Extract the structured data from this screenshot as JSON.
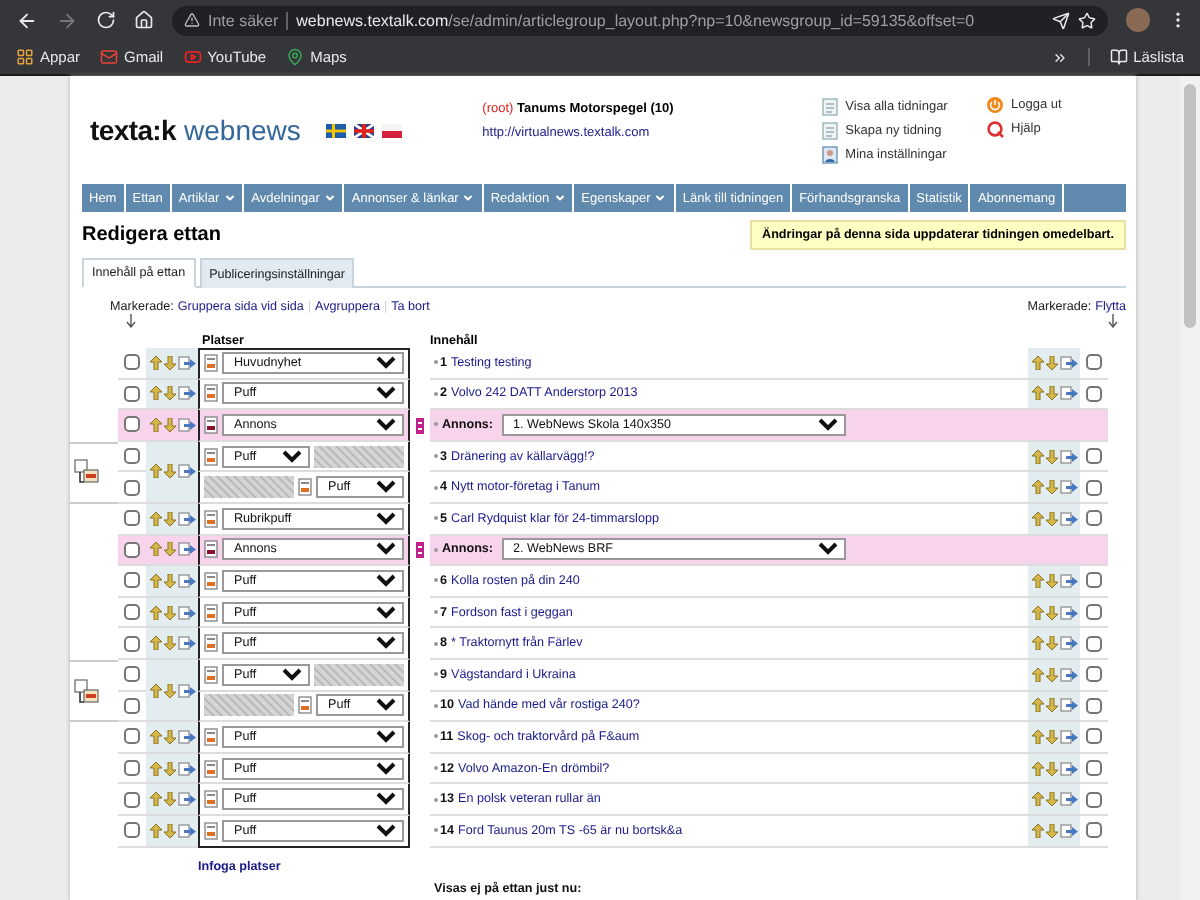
{
  "browser": {
    "security": "Inte säker",
    "url_host": "webnews.textalk.com",
    "url_path": "/se/admin/articlegroup_layout.php?np=10&newsgroup_id=59135&offset=0",
    "bookmarks": [
      {
        "label": "Appar",
        "kind": "apps"
      },
      {
        "label": "Gmail",
        "kind": "mail"
      },
      {
        "label": "YouTube",
        "kind": "video"
      },
      {
        "label": "Maps",
        "kind": "map"
      }
    ],
    "reading_list": "Läslista"
  },
  "header": {
    "logo_left": "texta:k",
    "logo_right": "webnews",
    "role": "(root)",
    "paper": "Tanums Motorspegel (10)",
    "paper_url": "http://virtualnews.textalk.com",
    "links": [
      {
        "label": "Visa alla tidningar",
        "kind": "list"
      },
      {
        "label": "Skapa ny tidning",
        "kind": "list"
      },
      {
        "label": "Mina inställningar",
        "kind": "user"
      }
    ],
    "links_right": [
      {
        "label": "Logga ut",
        "kind": "power"
      },
      {
        "label": "Hjälp",
        "kind": "help"
      }
    ]
  },
  "nav": [
    {
      "label": "Hem",
      "dropdown": false
    },
    {
      "label": "Ettan",
      "dropdown": false
    },
    {
      "label": "Artiklar",
      "dropdown": true
    },
    {
      "label": "Avdelningar",
      "dropdown": true
    },
    {
      "label": "Annonser & länkar",
      "dropdown": true
    },
    {
      "label": "Redaktion",
      "dropdown": true
    },
    {
      "label": "Egenskaper",
      "dropdown": true
    },
    {
      "label": "Länk till tidningen",
      "dropdown": false
    },
    {
      "label": "Förhandsgranska",
      "dropdown": false
    },
    {
      "label": "Statistik",
      "dropdown": false
    },
    {
      "label": "Abonnemang",
      "dropdown": false
    }
  ],
  "page_title": "Redigera ettan",
  "notice": "Ändringar på denna sida uppdaterar tidningen omedelbart.",
  "tabs": [
    {
      "label": "Innehåll på ettan",
      "selected": true
    },
    {
      "label": "Publiceringsinställningar",
      "selected": false
    }
  ],
  "bulk_left": {
    "label": "Markerade:",
    "separator": "|",
    "actions": [
      "Gruppera sida vid sida",
      "Avgruppera",
      "Ta bort"
    ]
  },
  "bulk_right": {
    "label": "Markerade:",
    "actions": [
      "Flytta"
    ]
  },
  "columns": {
    "places": "Platser",
    "content": "Innehåll"
  },
  "rows": [
    {
      "kind": "single",
      "place": "Huvudnyhet",
      "num": "1",
      "title": "Testing testing",
      "checked": false,
      "checked_right": false
    },
    {
      "kind": "single",
      "place": "Puff",
      "num": "2",
      "title": "Volvo 242 DATT Anderstorp 2013",
      "checked": false,
      "checked_right": false
    },
    {
      "kind": "ad",
      "place": "Annons",
      "ad_label": "Annons:",
      "ad_value": "1. WebNews Skola 140x350",
      "checked": false
    },
    {
      "kind": "pair",
      "items": [
        {
          "place": "Puff",
          "num": "3",
          "title": "Dränering av källarvägg!?",
          "checked": false,
          "checked_right": false
        },
        {
          "place": "Puff",
          "num": "4",
          "title": "Nytt motor-företag i Tanum",
          "checked": false,
          "checked_right": false
        }
      ]
    },
    {
      "kind": "single",
      "place": "Rubrikpuff",
      "num": "5",
      "title": "Carl Rydquist klar för 24-timmarslopp",
      "checked": false,
      "checked_right": false
    },
    {
      "kind": "ad",
      "place": "Annons",
      "ad_label": "Annons:",
      "ad_value": "2. WebNews BRF",
      "checked": false
    },
    {
      "kind": "single",
      "place": "Puff",
      "num": "6",
      "title": "Kolla rosten på din 240",
      "checked": false,
      "checked_right": false
    },
    {
      "kind": "single",
      "place": "Puff",
      "num": "7",
      "title": "Fordson fast i geggan",
      "checked": false,
      "checked_right": false
    },
    {
      "kind": "single",
      "place": "Puff",
      "num": "8",
      "title": "* Traktornytt från Färlev",
      "checked": false,
      "checked_right": false
    },
    {
      "kind": "pair",
      "items": [
        {
          "place": "Puff",
          "num": "9",
          "title": "Vägstandard i Ukraina",
          "checked": false,
          "checked_right": false
        },
        {
          "place": "Puff",
          "num": "10",
          "title": "Vad hände med vår rostiga 240?",
          "checked": false,
          "checked_right": false
        }
      ]
    },
    {
      "kind": "single",
      "place": "Puff",
      "num": "11",
      "title": "Skog- och traktorvård på F&aum",
      "checked": false,
      "checked_right": false
    },
    {
      "kind": "single",
      "place": "Puff",
      "num": "12",
      "title": "Volvo Amazon-En drömbil?",
      "checked": false,
      "checked_right": false
    },
    {
      "kind": "single",
      "place": "Puff",
      "num": "13",
      "title": "En polsk veteran rullar än",
      "checked": false,
      "checked_right": false
    },
    {
      "kind": "single",
      "place": "Puff",
      "num": "14",
      "title": "Ford Taunus 20m TS -65 är nu bortsk&a",
      "checked": false,
      "checked_right": false
    }
  ],
  "insert_link": "Infoga platser",
  "hidden_heading": "Visas ej på ettan just nu:"
}
